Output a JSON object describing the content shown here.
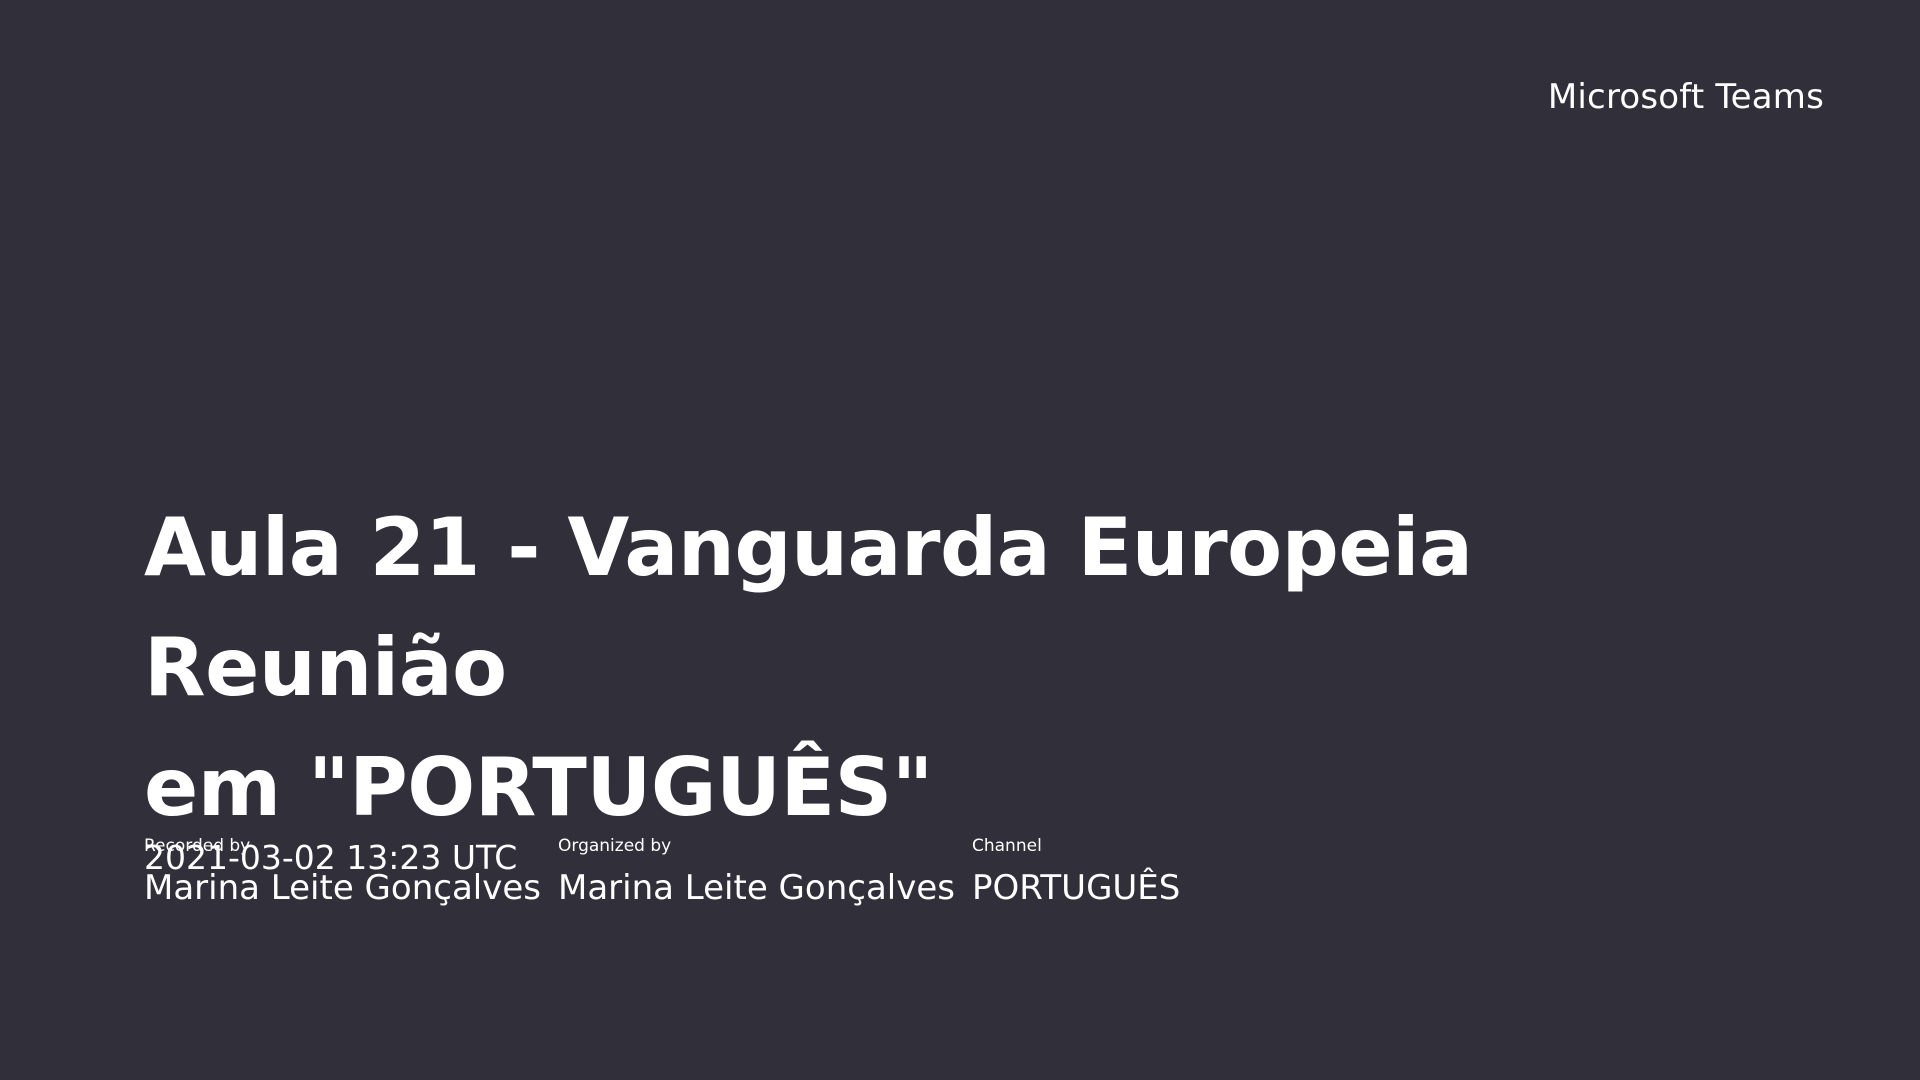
{
  "app": {
    "brand": "Microsoft Teams"
  },
  "recording": {
    "title_line1": "Aula 21 - Vanguarda Europeia Reunião",
    "title_line2": "em \"PORTUGUÊS\"",
    "datetime": "2021-03-02 13:23 UTC"
  },
  "meta": {
    "recorded_by_label": "Recorded by",
    "recorded_by_value": "Marina Leite Gonçalves",
    "organized_by_label": "Organized by",
    "organized_by_value": "Marina Leite Gonçalves",
    "channel_label": "Channel",
    "channel_value": "PORTUGUÊS"
  },
  "colors": {
    "background": "#302f3a",
    "text": "#ffffff"
  }
}
